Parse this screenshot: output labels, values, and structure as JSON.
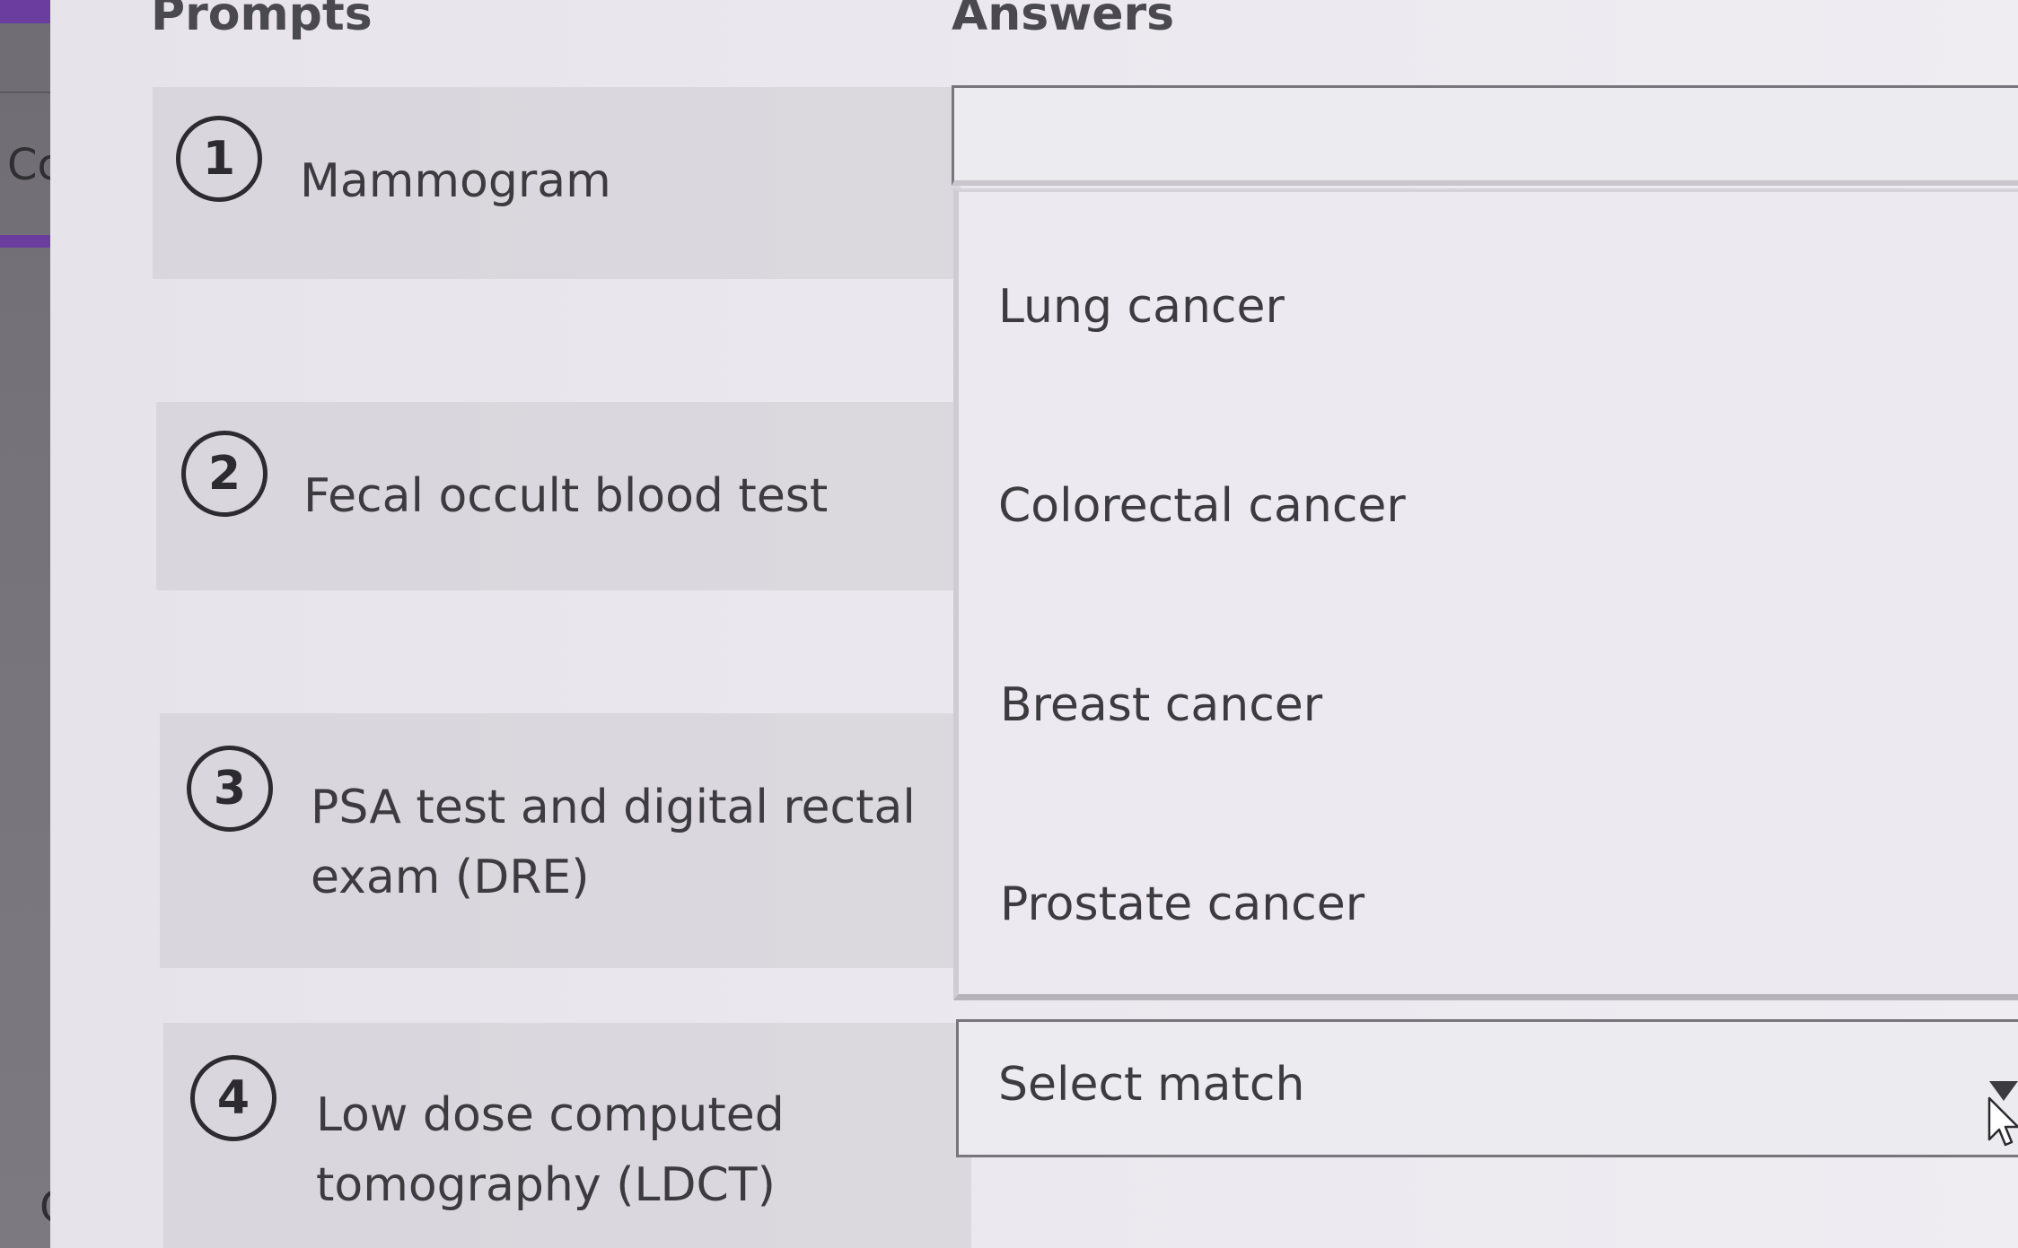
{
  "sidebar": {
    "letter_top": "Cc",
    "letter_bottom": "C"
  },
  "headers": {
    "prompts": "Prompts",
    "answers": "Answers"
  },
  "prompts": [
    {
      "number": "1",
      "text": "Mammogram"
    },
    {
      "number": "2",
      "text": "Fecal occult blood test"
    },
    {
      "number": "3",
      "text": "PSA test and digital rectal exam (DRE)"
    },
    {
      "number": "4",
      "text": "Low dose computed tomography (LDCT)"
    }
  ],
  "answers": {
    "options": [
      "Lung cancer",
      "Colorectal cancer",
      "Breast cancer",
      "Prostate cancer"
    ],
    "select_placeholder": "Select match"
  },
  "icons": {
    "dropdown": "caret-down-icon",
    "cursor": "mouse-pointer-icon"
  }
}
